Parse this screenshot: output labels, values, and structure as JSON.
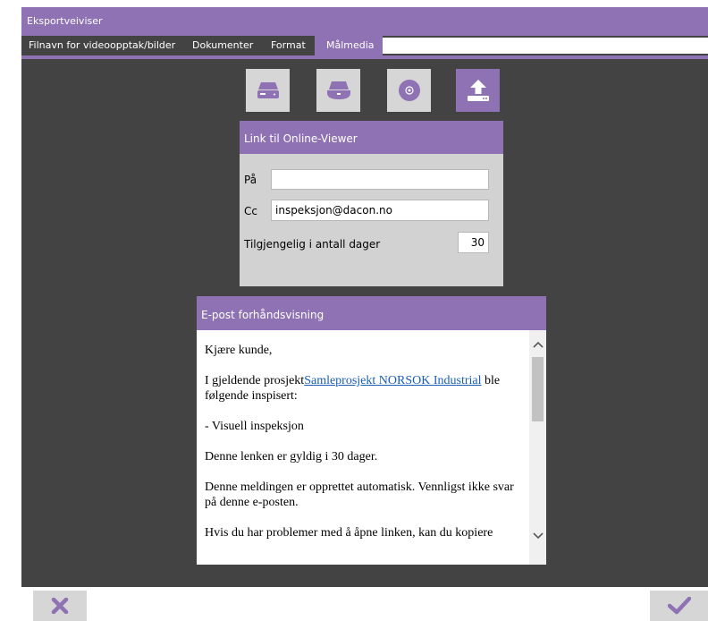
{
  "window": {
    "title": "Eksportveiviser"
  },
  "tabs": [
    {
      "label": "Filnavn for videoopptak/bilder"
    },
    {
      "label": "Dokumenter"
    },
    {
      "label": "Format"
    },
    {
      "label": "Målmedia"
    }
  ],
  "active_tab": "Målmedia",
  "media_targets": [
    {
      "icon": "hard-drive-icon",
      "selected": false
    },
    {
      "icon": "usb-drive-icon",
      "selected": false
    },
    {
      "icon": "disc-icon",
      "selected": false
    },
    {
      "icon": "upload-icon",
      "selected": true
    }
  ],
  "link_panel": {
    "title": "Link til Online-Viewer",
    "to_label": "På",
    "to_value": "",
    "cc_label": "Cc",
    "cc_value": "inspeksjon@dacon.no",
    "days_label": "Tilgjengelig i antall dager",
    "days_value": "30"
  },
  "email_preview": {
    "title": "E-post forhåndsvisning",
    "greeting": "Kjære kunde,",
    "project_prefix": "I gjeldende prosjekt",
    "project_link": "Samleprosjekt NORSOK Industrial",
    "project_suffix": " ble følgende inspisert:",
    "item": "- Visuell inspeksjon",
    "validity": "Denne lenken er gyldig i 30 dager.",
    "auto_note": "Denne meldingen er opprettet automatisk. Vennligst ikke svar på denne e-posten.",
    "help": "Hvis du har problemer med å åpne linken, kan du kopiere"
  },
  "footer": {
    "cancel_icon": "close-icon",
    "confirm_icon": "checkmark-icon"
  },
  "colors": {
    "accent": "#8f72b4",
    "background": "#434343",
    "panel": "#d2d2d2",
    "button": "#d6d6d6",
    "link": "#1a5fb4"
  }
}
